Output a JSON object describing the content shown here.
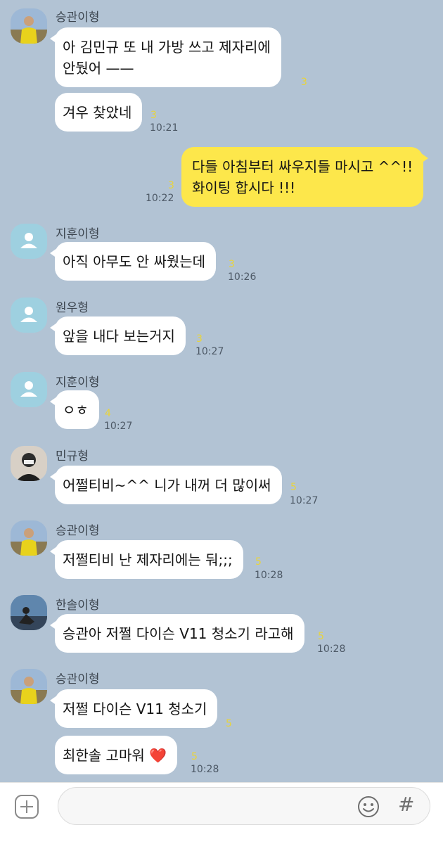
{
  "messages": [
    {
      "sender": "승관이형",
      "lines": [
        "아 김민규 또 내 가방 쓰고 제자리에",
        "안뒀어 ——"
      ],
      "unread": "3"
    },
    {
      "lines": [
        "겨우 찾았네"
      ],
      "unread": "3",
      "time": "10:21"
    },
    {
      "outgoing": true,
      "lines": [
        "다들 아침부터 싸우지들 마시고 ^^!!",
        "화이팅 합시다 !!!"
      ],
      "unread": "3",
      "time": "10:22"
    },
    {
      "sender": "지훈이형",
      "lines": [
        "아직 아무도 안 싸웠는데"
      ],
      "unread": "3",
      "time": "10:26"
    },
    {
      "sender": "원우형",
      "lines": [
        "앞을 내다 보는거지"
      ],
      "unread": "3",
      "time": "10:27"
    },
    {
      "sender": "지훈이형",
      "lines": [
        "ㅇㅎ"
      ],
      "unread": "4",
      "time": "10:27"
    },
    {
      "sender": "민규형",
      "lines": [
        "어쩔티비~^^ 니가 내꺼 더 많이써"
      ],
      "unread": "5",
      "time": "10:27"
    },
    {
      "sender": "승관이형",
      "lines": [
        "저쩔티비 난 제자리에는 둬;;;"
      ],
      "unread": "5",
      "time": "10:28"
    },
    {
      "sender": "한솔이형",
      "lines": [
        "승관아 저쩔 다이슨 V11 청소기 라고해"
      ],
      "unread": "5",
      "time": "10:28"
    },
    {
      "sender": "승관이형",
      "lines": [
        "저쩔 다이슨 V11 청소기"
      ],
      "unread": "5"
    },
    {
      "lines": [
        "최한솔 고마워 ❤️"
      ],
      "unread": "5",
      "time": "10:28"
    }
  ],
  "input": {
    "value": "",
    "placeholder": ""
  },
  "toolbar": {
    "hash_label": "#"
  },
  "colors": {
    "background": "#b2c3d4",
    "incoming_bubble": "#ffffff",
    "outgoing_bubble": "#fde74b",
    "unread_count": "#e9d43a",
    "default_avatar": "#9ed0e0"
  },
  "icons": {
    "attach": "plus-square-icon",
    "emoji": "smiley-icon",
    "hashtag": "hash-icon"
  }
}
